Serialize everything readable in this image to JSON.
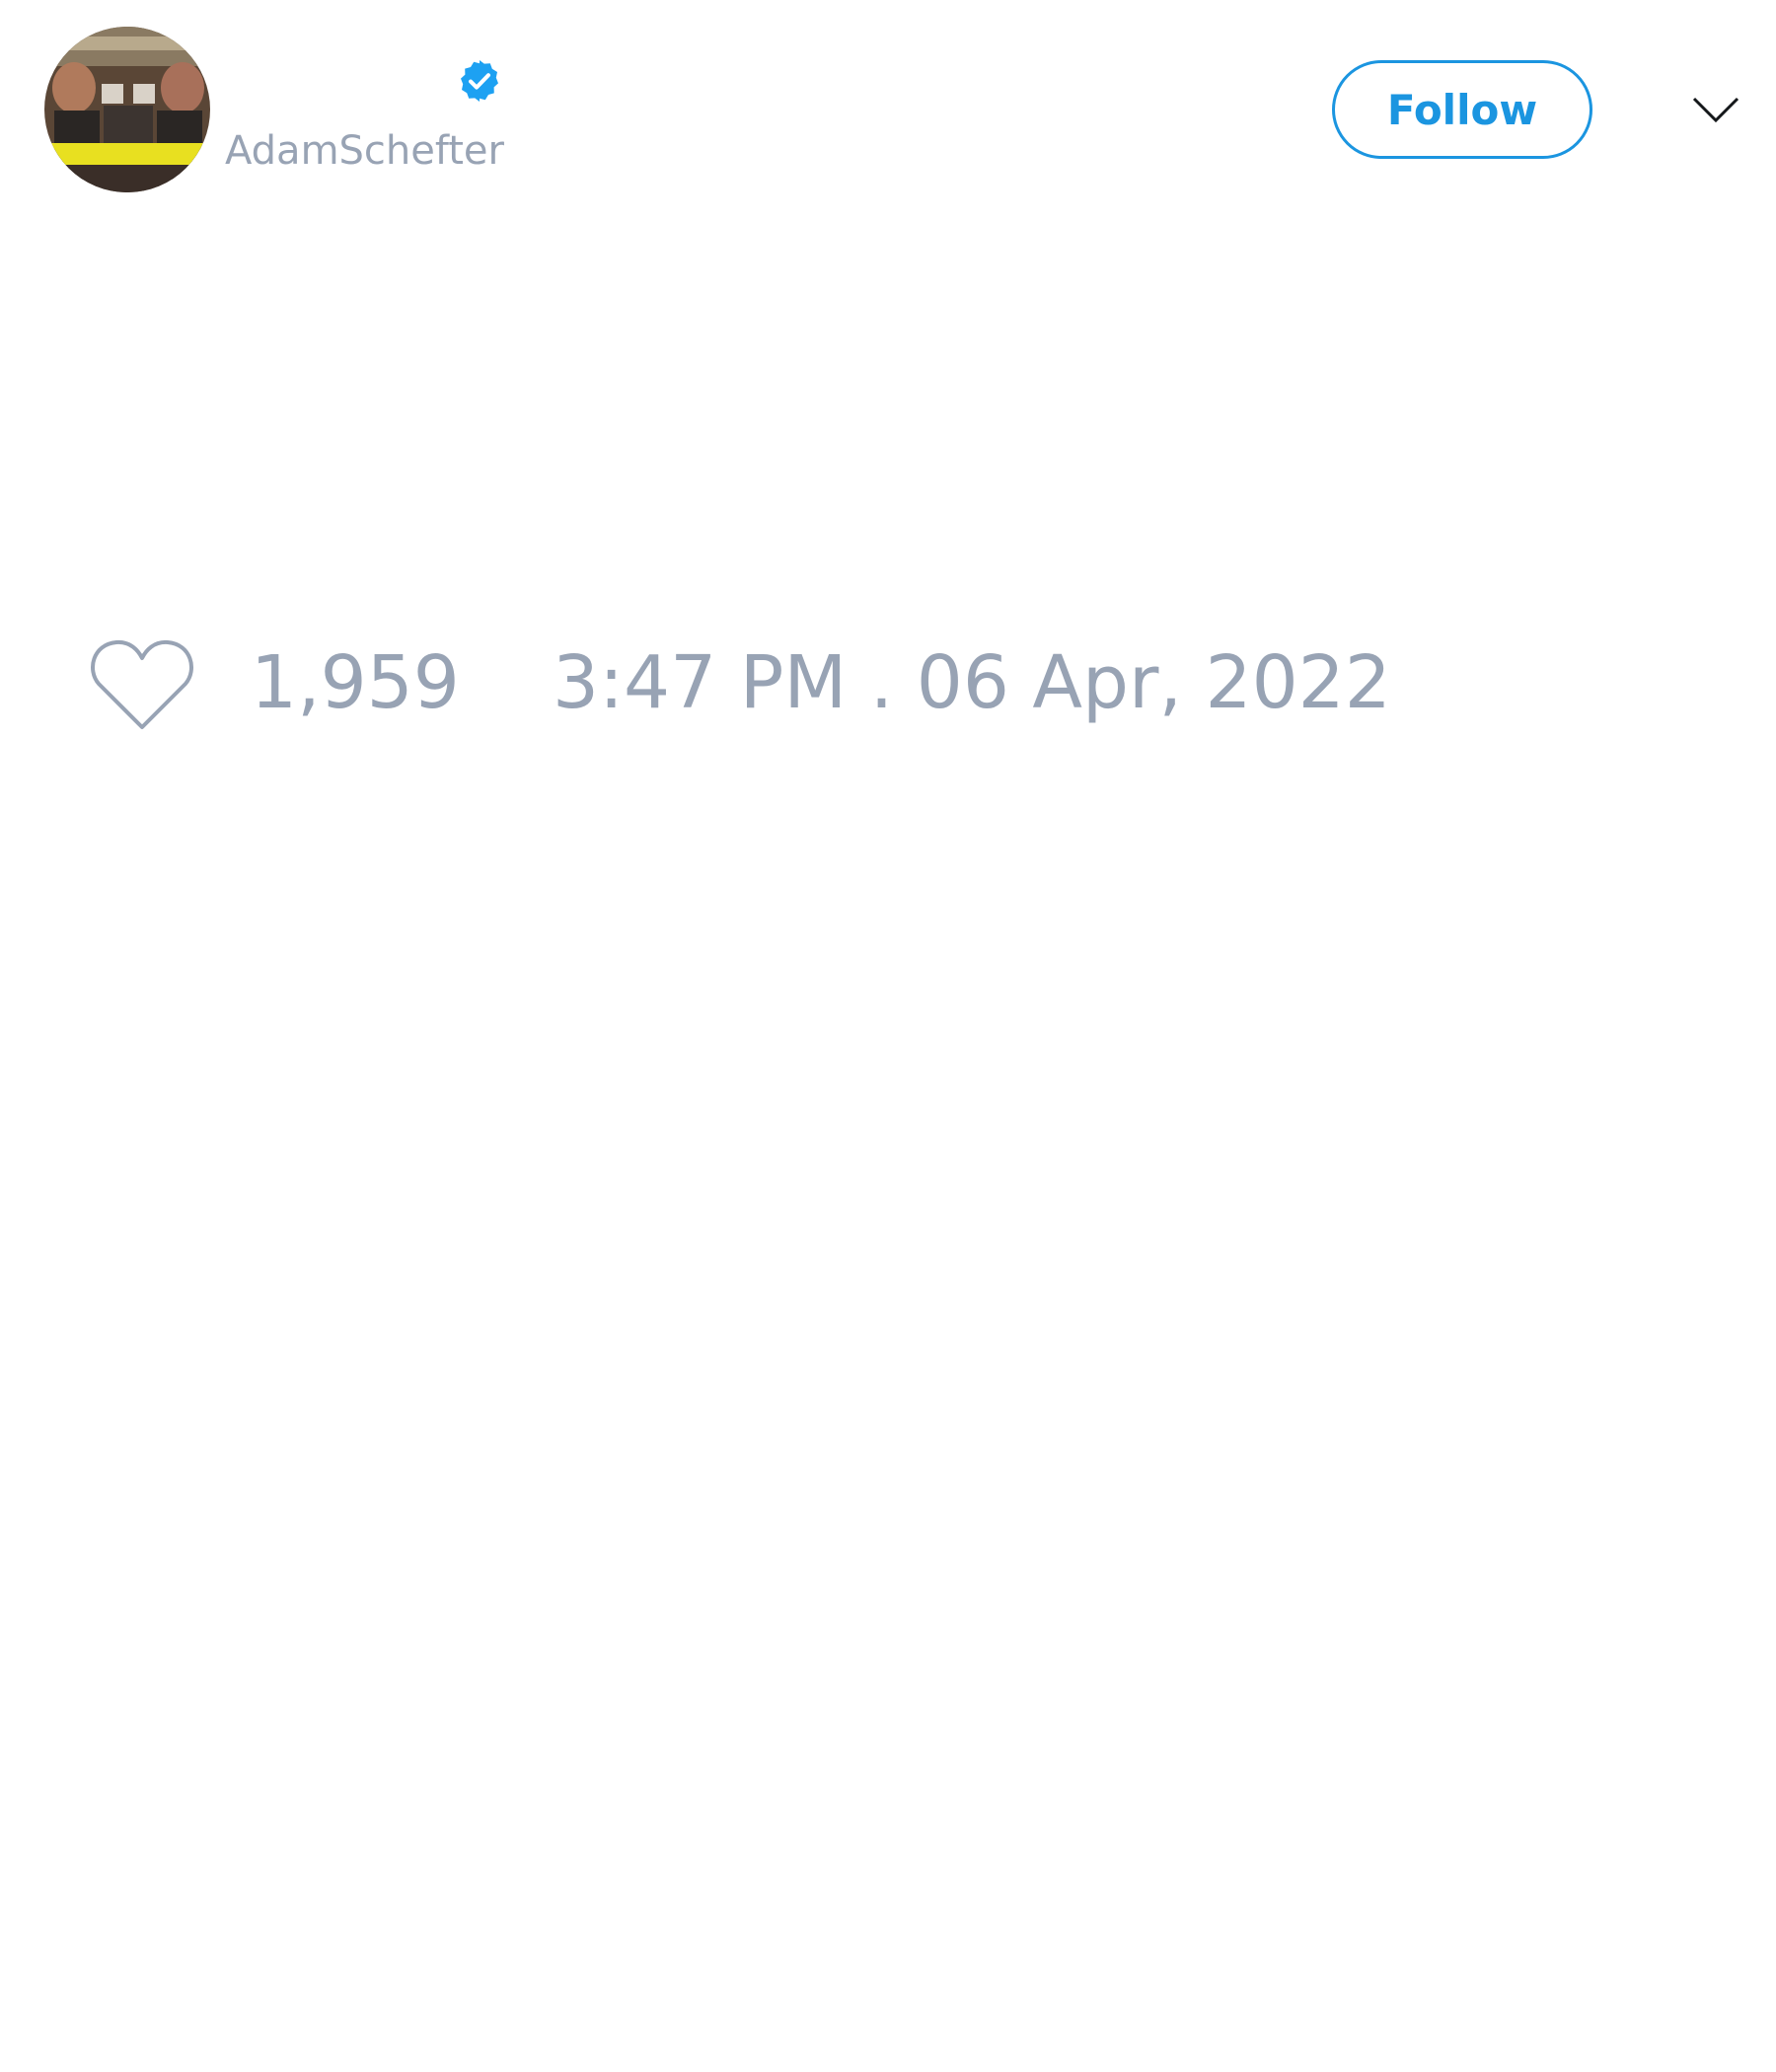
{
  "tweet": {
    "author": {
      "handle": "AdamSchefter",
      "verified": true,
      "avatar_icon": "profile-photo"
    },
    "follow_button_label": "Follow",
    "menu_icon": "chevron-down-icon",
    "likes": {
      "icon": "heart-icon",
      "count": "1,959"
    },
    "timestamp": "3:47 PM . 06 Apr, 2022"
  },
  "colors": {
    "accent": "#1b95e0",
    "muted_text": "#98a3b4",
    "verified_badge": "#1da1f2",
    "background": "#ffffff"
  }
}
